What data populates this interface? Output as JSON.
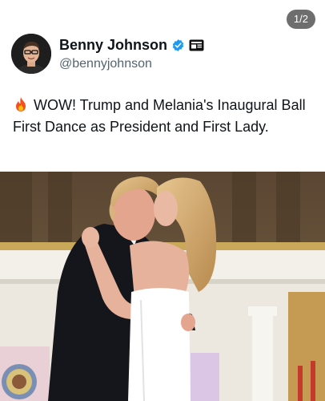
{
  "header": {
    "media_counter": "1/2"
  },
  "author": {
    "display_name": "Benny Johnson",
    "handle": "@bennyjohnson",
    "verified": true,
    "affiliation_badge": "news-badge"
  },
  "tweet": {
    "emoji_icon": "fire-icon",
    "text": "WOW! Trump and Melania's Inaugural Ball First Dance as President and First Lady."
  },
  "media": {
    "type": "photo",
    "index": 1,
    "total": 2
  },
  "colors": {
    "text": "#0f1419",
    "handle": "#536471",
    "verified_blue": "#1d9bf0",
    "counter_bg": "#6e6e6e"
  }
}
